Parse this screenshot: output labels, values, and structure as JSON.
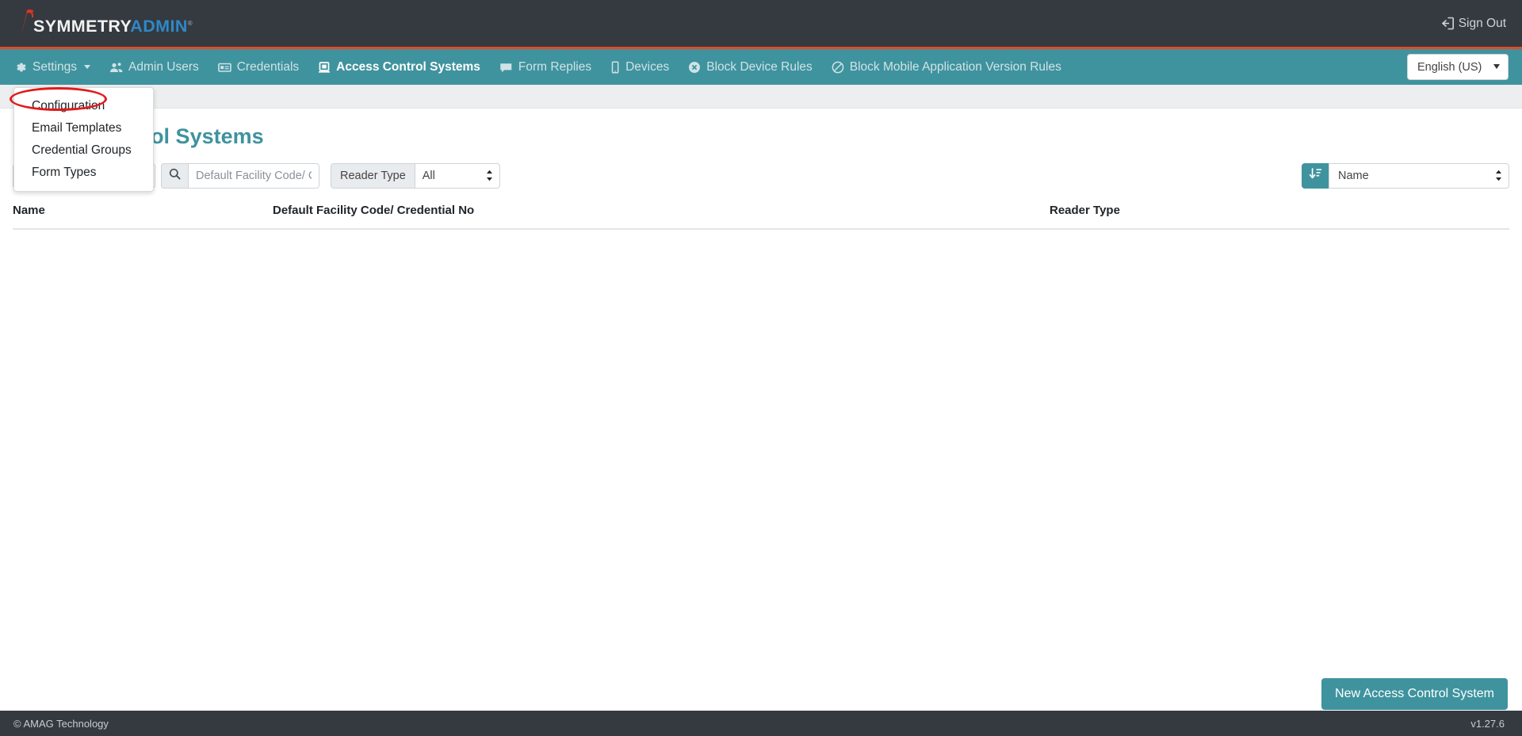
{
  "topbar": {
    "brand_part1": "SYMMETRY",
    "brand_part2": "ADMIN",
    "brand_tm": "®",
    "signout_label": "Sign Out",
    "signout_icon": "sign-out-icon",
    "background": "#343a40"
  },
  "nav": {
    "accent_line_color": "#e04b25",
    "background": "#3f939e",
    "items": [
      {
        "label": "Settings",
        "icon": "gear-icon",
        "active": false,
        "has_caret": true
      },
      {
        "label": "Admin Users",
        "icon": "users-icon",
        "active": false,
        "has_caret": false
      },
      {
        "label": "Credentials",
        "icon": "id-card-icon",
        "active": false,
        "has_caret": false
      },
      {
        "label": "Access Control Systems",
        "icon": "door-panel-icon",
        "active": true,
        "has_caret": false
      },
      {
        "label": "Form Replies",
        "icon": "comment-icon",
        "active": false,
        "has_caret": false
      },
      {
        "label": "Devices",
        "icon": "mobile-icon",
        "active": false,
        "has_caret": false
      },
      {
        "label": "Block Device Rules",
        "icon": "times-circle-icon",
        "active": false,
        "has_caret": false
      },
      {
        "label": "Block Mobile Application Version Rules",
        "icon": "ban-icon",
        "active": false,
        "has_caret": false
      }
    ],
    "language": {
      "selected": "English (US)",
      "options": [
        "English (US)"
      ]
    }
  },
  "settings_menu": {
    "open": true,
    "highlighted_item": "Configuration",
    "highlight_color": "#e21b1b",
    "items": [
      {
        "label": "Configuration"
      },
      {
        "label": "Email Templates"
      },
      {
        "label": "Credential Groups"
      },
      {
        "label": "Form Types"
      }
    ]
  },
  "page": {
    "title": "Access Control Systems",
    "title_color": "#3f939e"
  },
  "toolbar": {
    "name_filter_value": "",
    "name_filter_placeholder": "",
    "search_icon": "magnifier-icon",
    "search_placeholder": "Default Facility Code/ Credential No",
    "search_value": "",
    "reader_type_label": "Reader Type",
    "reader_type_selected": "All",
    "reader_type_options": [
      "All"
    ],
    "sort_icon": "sort-amount-down-icon",
    "sort_selected": "Name",
    "sort_options": [
      "Name"
    ]
  },
  "table": {
    "columns": [
      {
        "label": "Name"
      },
      {
        "label": "Default Facility Code/ Credential No"
      },
      {
        "label": "Reader Type"
      }
    ],
    "rows": []
  },
  "actions": {
    "new_button_label": "New Access Control System",
    "new_button_color": "#3f939e"
  },
  "footer": {
    "copyright": "© AMAG Technology",
    "version": "v1.27.6",
    "background": "#343a40"
  }
}
